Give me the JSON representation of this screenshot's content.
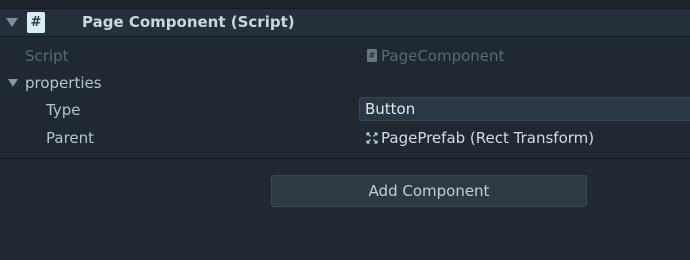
{
  "header": {
    "title": "Page Component (Script)",
    "icon_glyph": "#",
    "icon": "csharp-script-icon"
  },
  "fields": {
    "script_label": "Script",
    "script_value": "PageComponent",
    "properties_label": "properties",
    "type_label": "Type",
    "type_value": "Button",
    "parent_label": "Parent",
    "parent_value": "PagePrefab (Rect Transform)"
  },
  "add_component_label": "Add Component",
  "colors": {
    "background": "#202831",
    "header": "#26303b",
    "field": "#2b3743"
  }
}
